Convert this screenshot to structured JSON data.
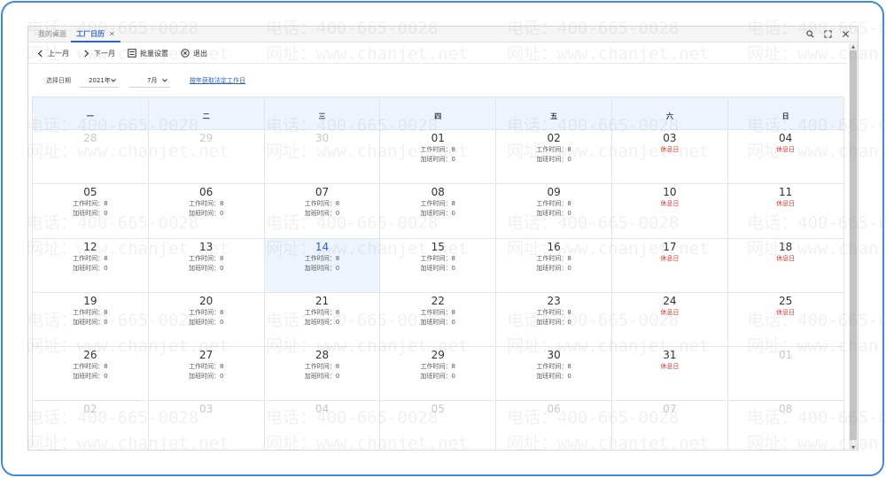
{
  "tabs": [
    {
      "label": "我的桌面"
    },
    {
      "label": "工厂日历",
      "close": "✕"
    }
  ],
  "toolbar": {
    "prev_month": "上一月",
    "next_month": "下一月",
    "batch_settings": "批量设置",
    "exit": "退出"
  },
  "filter": {
    "label": "选择日期",
    "year": "2021年",
    "month": "7月",
    "link": "按年获取法定工作日"
  },
  "weekdays": [
    "一",
    "二",
    "三",
    "四",
    "五",
    "六",
    "日"
  ],
  "labels": {
    "work_time": "工作时间：",
    "overtime": "加班时间：",
    "rest": "休息日"
  },
  "days": [
    {
      "num": "28",
      "type": "other"
    },
    {
      "num": "29",
      "type": "other"
    },
    {
      "num": "30",
      "type": "other"
    },
    {
      "num": "01",
      "type": "work",
      "work": "8",
      "ot": "0"
    },
    {
      "num": "02",
      "type": "work",
      "work": "8",
      "ot": "0"
    },
    {
      "num": "03",
      "type": "rest"
    },
    {
      "num": "04",
      "type": "rest"
    },
    {
      "num": "05",
      "type": "work",
      "work": "8",
      "ot": "0"
    },
    {
      "num": "06",
      "type": "work",
      "work": "8",
      "ot": "0"
    },
    {
      "num": "07",
      "type": "work",
      "work": "8",
      "ot": "0"
    },
    {
      "num": "08",
      "type": "work",
      "work": "8",
      "ot": "0"
    },
    {
      "num": "09",
      "type": "work",
      "work": "8",
      "ot": "0"
    },
    {
      "num": "10",
      "type": "rest"
    },
    {
      "num": "11",
      "type": "rest"
    },
    {
      "num": "12",
      "type": "work",
      "work": "8",
      "ot": "0"
    },
    {
      "num": "13",
      "type": "work",
      "work": "8",
      "ot": "0"
    },
    {
      "num": "14",
      "type": "today",
      "work": "8",
      "ot": "0"
    },
    {
      "num": "15",
      "type": "work",
      "work": "8",
      "ot": "0"
    },
    {
      "num": "16",
      "type": "work",
      "work": "8",
      "ot": "0"
    },
    {
      "num": "17",
      "type": "rest"
    },
    {
      "num": "18",
      "type": "rest"
    },
    {
      "num": "19",
      "type": "work",
      "work": "8",
      "ot": "0"
    },
    {
      "num": "20",
      "type": "work",
      "work": "8",
      "ot": "0"
    },
    {
      "num": "21",
      "type": "work",
      "work": "8",
      "ot": "0"
    },
    {
      "num": "22",
      "type": "work",
      "work": "8",
      "ot": "0"
    },
    {
      "num": "23",
      "type": "work",
      "work": "8",
      "ot": "0"
    },
    {
      "num": "24",
      "type": "rest"
    },
    {
      "num": "25",
      "type": "rest"
    },
    {
      "num": "26",
      "type": "work",
      "work": "8",
      "ot": "0"
    },
    {
      "num": "27",
      "type": "work",
      "work": "8",
      "ot": "0"
    },
    {
      "num": "28",
      "type": "work",
      "work": "8",
      "ot": "0"
    },
    {
      "num": "29",
      "type": "work",
      "work": "8",
      "ot": "0"
    },
    {
      "num": "30",
      "type": "work",
      "work": "8",
      "ot": "0"
    },
    {
      "num": "31",
      "type": "rest"
    },
    {
      "num": "01",
      "type": "other"
    },
    {
      "num": "02",
      "type": "other"
    },
    {
      "num": "03",
      "type": "other"
    },
    {
      "num": "04",
      "type": "other"
    },
    {
      "num": "05",
      "type": "other"
    },
    {
      "num": "06",
      "type": "other"
    },
    {
      "num": "07",
      "type": "other"
    },
    {
      "num": "08",
      "type": "other"
    }
  ],
  "watermark": {
    "phone": "电话：400-665-0028",
    "site": "网址：www.chanjet.net"
  },
  "colors": {
    "accent": "#2c62c9",
    "rest": "#e0362c",
    "frame": "#3d8be0"
  }
}
